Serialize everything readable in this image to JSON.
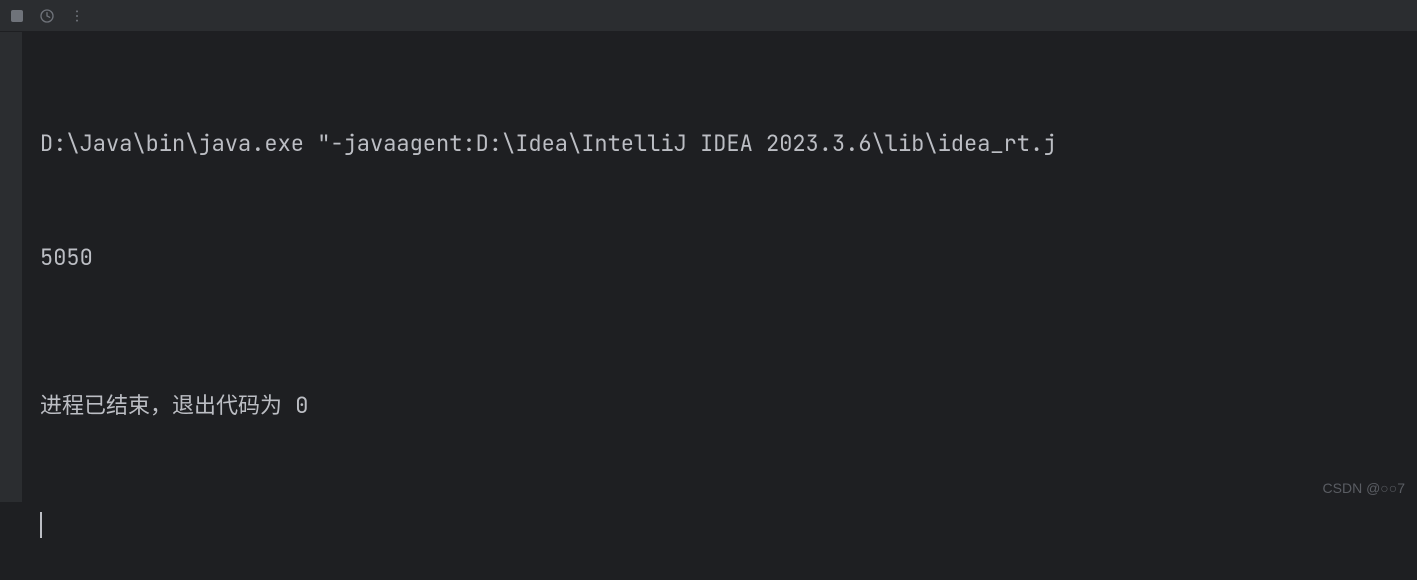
{
  "toolbar": {
    "stop_icon": "stop",
    "rerun_icon": "rerun",
    "more_icon": "more"
  },
  "console": {
    "command_line": "D:\\Java\\bin\\java.exe \"-javaagent:D:\\Idea\\IntelliJ IDEA 2023.3.6\\lib\\idea_rt.j",
    "output_value": "5050",
    "exit_message": "进程已结束，退出代码为 0"
  },
  "watermark": "CSDN @○○7"
}
